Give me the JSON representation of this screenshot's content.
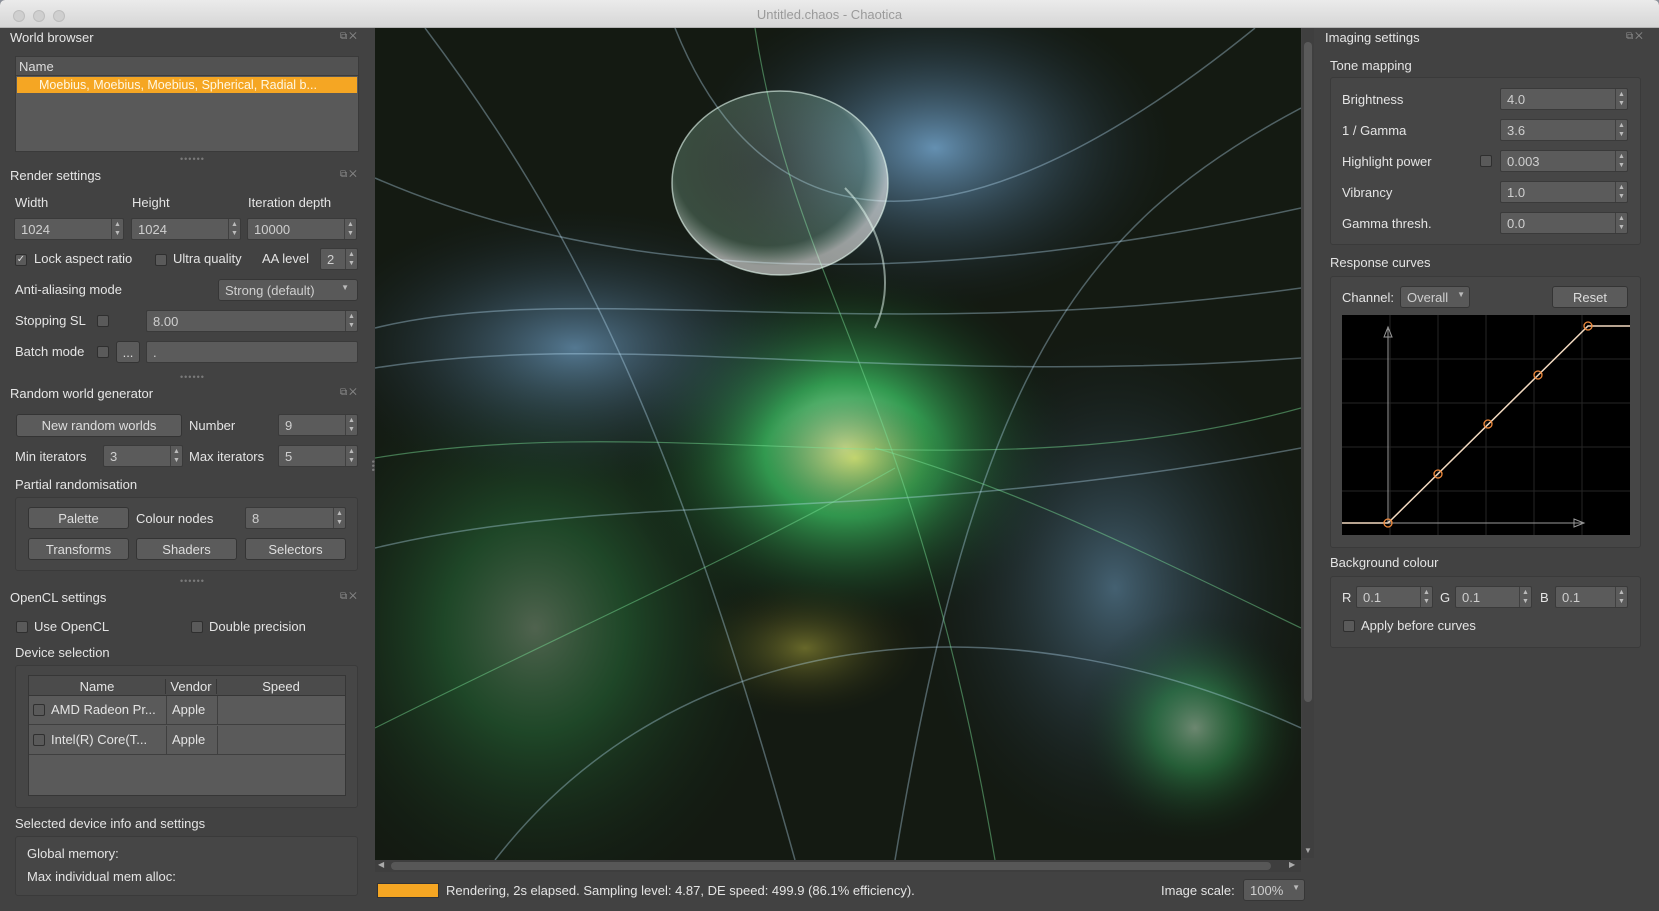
{
  "window": {
    "title": "Untitled.chaos - Chaotica"
  },
  "world_browser": {
    "title": "World browser",
    "column_name": "Name",
    "selected_item": "Moebius, Moebius, Moebius, Spherical, Radial b..."
  },
  "render_settings": {
    "title": "Render settings",
    "width_label": "Width",
    "width_value": "1024",
    "height_label": "Height",
    "height_value": "1024",
    "iteration_label": "Iteration depth",
    "iteration_value": "10000",
    "lock_aspect_label": "Lock aspect ratio",
    "lock_aspect_checked": true,
    "ultra_quality_label": "Ultra quality",
    "aa_level_label": "AA level",
    "aa_level_value": "2",
    "aa_mode_label": "Anti-aliasing mode",
    "aa_mode_value": "Strong (default)",
    "stopping_sl_label": "Stopping SL",
    "stopping_sl_value": "8.00",
    "batch_mode_label": "Batch mode",
    "batch_button": "...",
    "batch_path": "."
  },
  "random_world_generator": {
    "title": "Random world generator",
    "new_button": "New random worlds",
    "number_label": "Number",
    "number_value": "9",
    "min_iter_label": "Min iterators",
    "min_iter_value": "3",
    "max_iter_label": "Max iterators",
    "max_iter_value": "5",
    "partial_label": "Partial randomisation",
    "palette_button": "Palette",
    "colour_nodes_label": "Colour nodes",
    "colour_nodes_value": "8",
    "transforms_button": "Transforms",
    "shaders_button": "Shaders",
    "selectors_button": "Selectors"
  },
  "opencl": {
    "title": "OpenCL settings",
    "use_label": "Use OpenCL",
    "double_label": "Double precision",
    "device_selection_label": "Device selection",
    "columns": [
      "Name",
      "Vendor",
      "Speed"
    ],
    "devices": [
      {
        "name": "AMD Radeon Pr...",
        "vendor": "Apple",
        "speed": ""
      },
      {
        "name": "Intel(R) Core(T...",
        "vendor": "Apple",
        "speed": ""
      }
    ],
    "selected_info_label": "Selected device info and settings",
    "global_memory_label": "Global memory:",
    "max_alloc_label": "Max individual mem alloc:"
  },
  "imaging": {
    "title": "Imaging settings",
    "tone_mapping_label": "Tone mapping",
    "brightness_label": "Brightness",
    "brightness_value": "4.0",
    "gamma_label": "1 / Gamma",
    "gamma_value": "3.6",
    "highlight_label": "Highlight power",
    "highlight_value": "0.003",
    "vibrancy_label": "Vibrancy",
    "vibrancy_value": "1.0",
    "gamma_thresh_label": "Gamma thresh.",
    "gamma_thresh_value": "0.0",
    "response_curves_label": "Response curves",
    "channel_label": "Channel:",
    "channel_value": "Overall",
    "reset_button": "Reset",
    "background_label": "Background colour",
    "r_label": "R",
    "r_value": "0.1",
    "g_label": "G",
    "g_value": "0.1",
    "b_label": "B",
    "b_value": "0.1",
    "apply_before_label": "Apply before curves"
  },
  "status": {
    "text": "Rendering, 2s elapsed. Sampling level: 4.87, DE speed: 499.9 (86.1% efficiency).",
    "progress": 1.0,
    "image_scale_label": "Image scale:",
    "image_scale_value": "100%"
  },
  "colors": {
    "accent": "#f5a623",
    "panel": "#424242"
  }
}
